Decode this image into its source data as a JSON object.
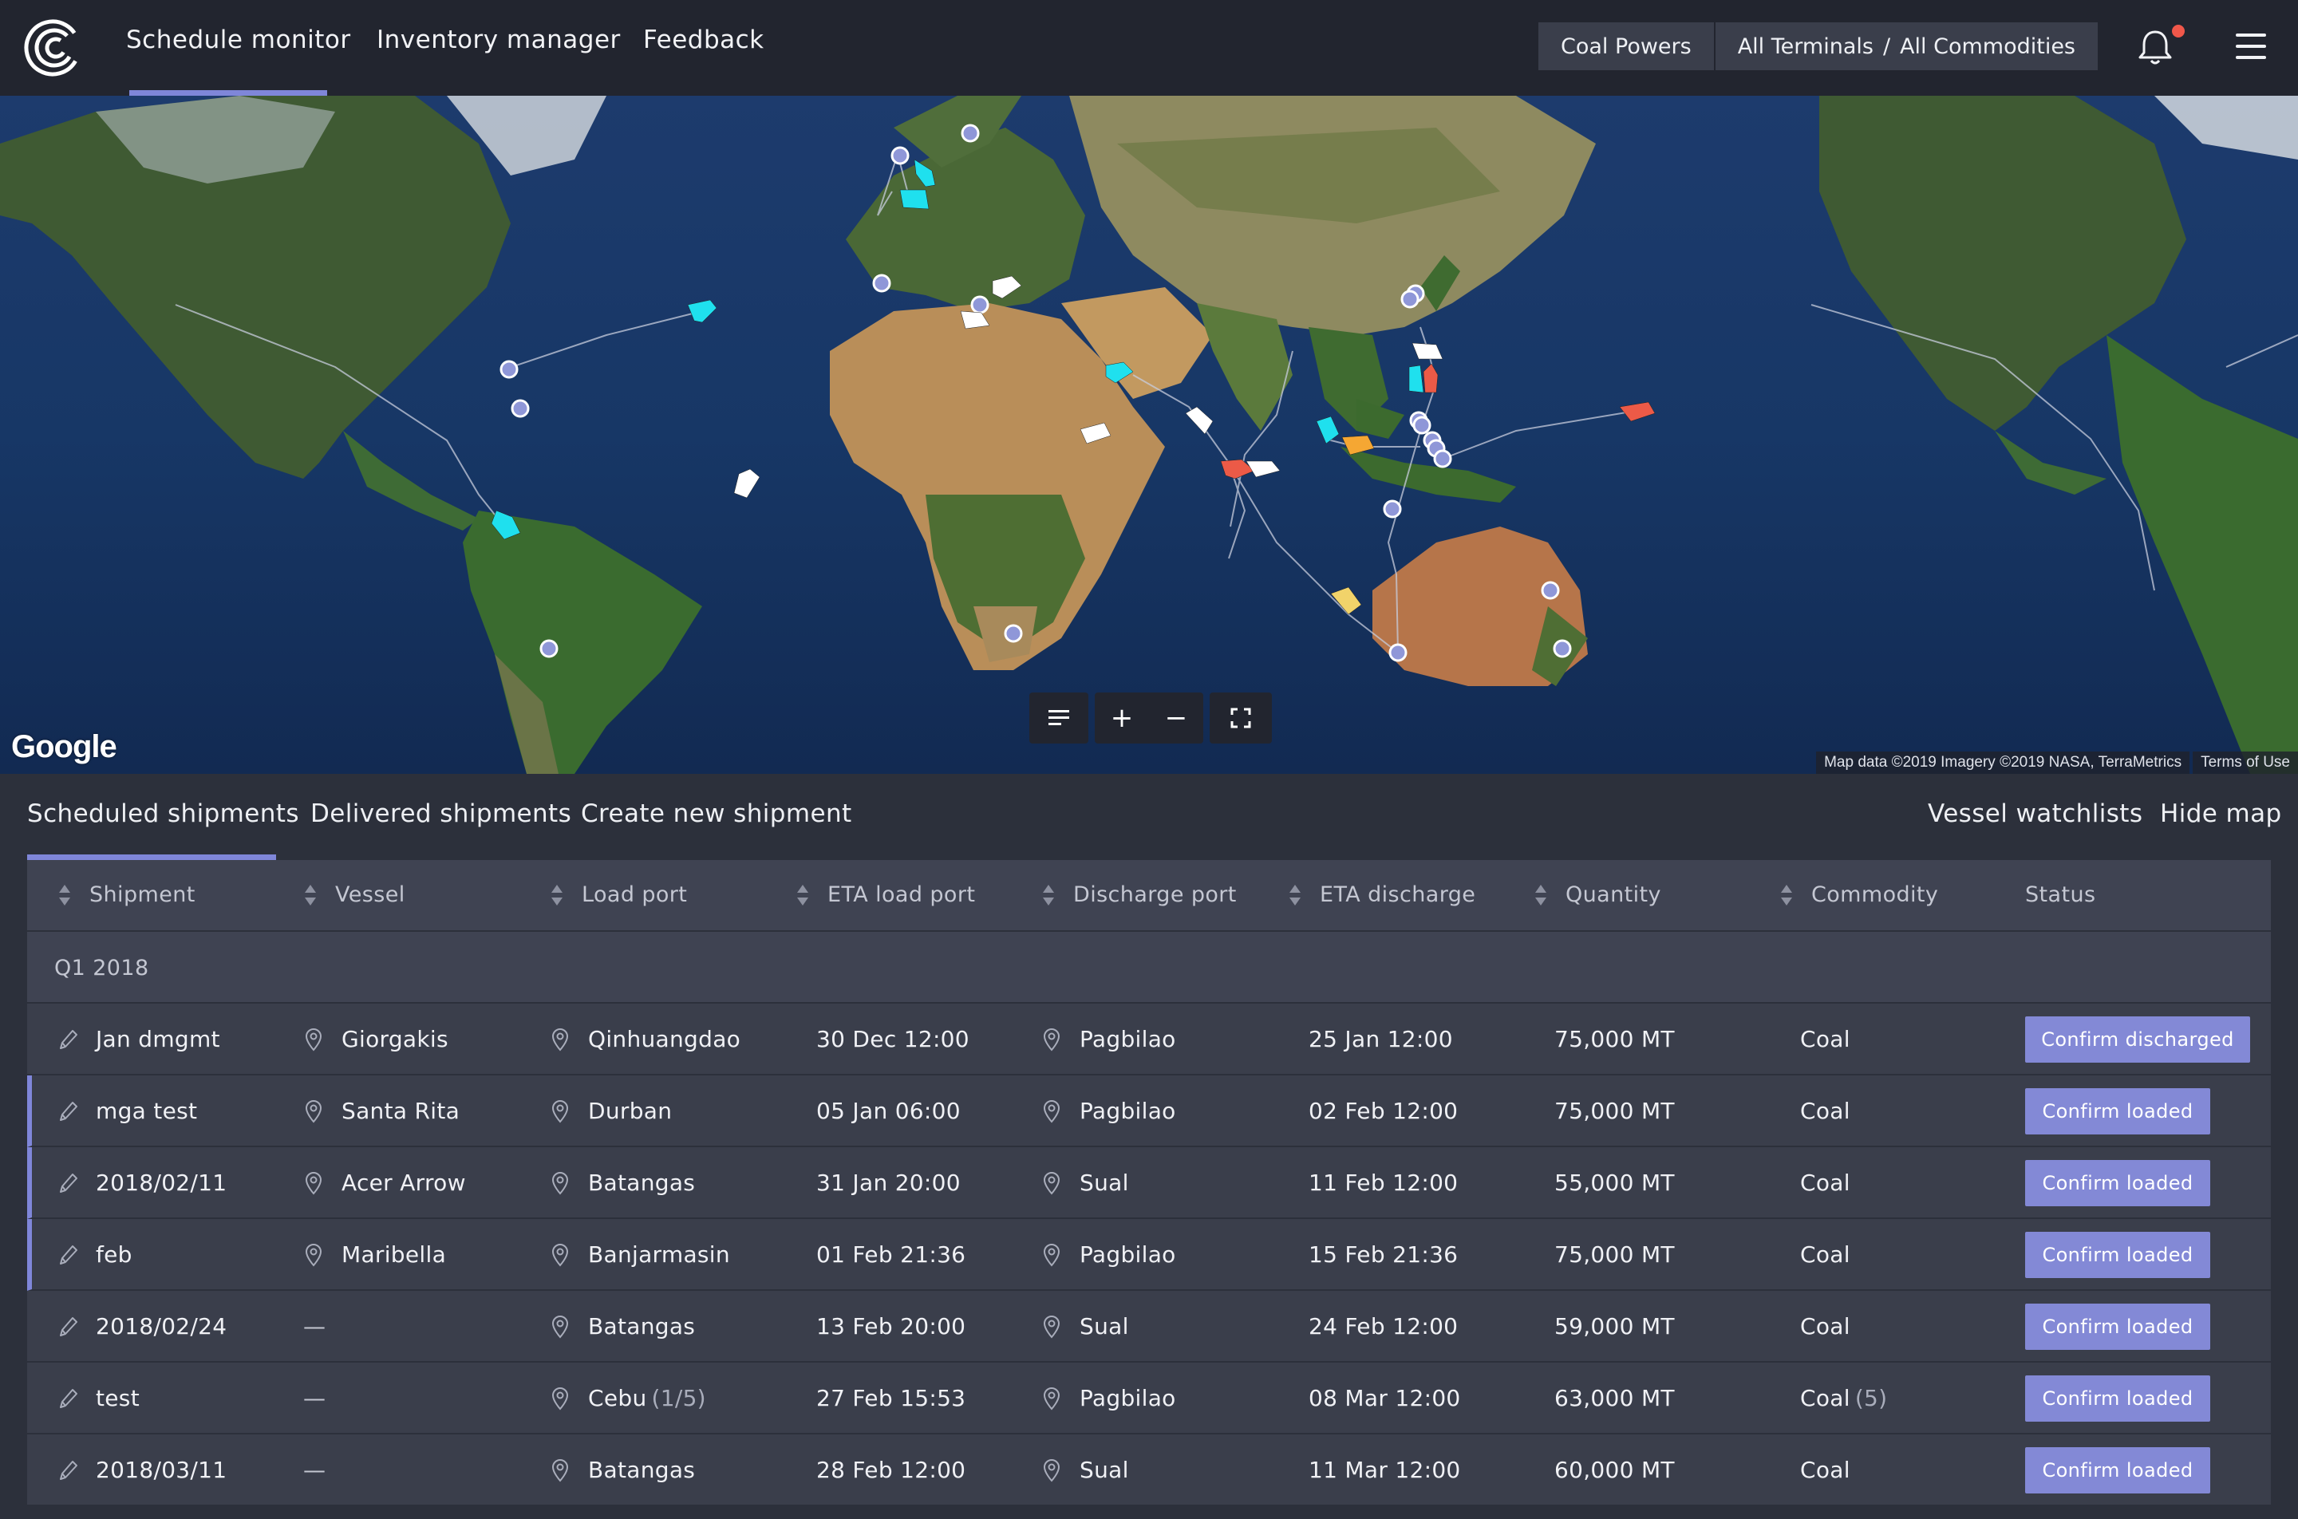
{
  "nav": {
    "links": [
      "Schedule monitor",
      "Inventory manager",
      "Feedback"
    ],
    "company": "Coal Powers",
    "terminals": "All Terminals",
    "separator": "/",
    "commodities": "All Commodities",
    "icons": [
      "logo-icon",
      "bell-icon",
      "hamburger-menu-icon"
    ],
    "notification": true
  },
  "map": {
    "logo": "Google",
    "attribution": "Map data ©2019 Imagery ©2019 NASA, TerraMetrics",
    "terms": "Terms of Use",
    "controls": {
      "legend": "list-icon",
      "zoom_in": "+",
      "zoom_out": "−",
      "fullscreen": "fullscreen-icon"
    },
    "vessel_colors": {
      "cyan": "#1fe0ee",
      "white": "#ffffff",
      "red": "#ec5a47",
      "orange": "#f5a733",
      "yellow": "#f1d36a"
    },
    "port_color": "#8f97d8"
  },
  "tabs": {
    "scheduled": "Scheduled shipments",
    "delivered": "Delivered shipments",
    "create": "Create new shipment",
    "watchlists": "Vessel watchlists",
    "hide_map": "Hide map"
  },
  "table": {
    "headers": [
      "Shipment",
      "Vessel",
      "Load port",
      "ETA load port",
      "Discharge port",
      "ETA discharge",
      "Quantity",
      "Commodity",
      "Status"
    ],
    "group": "Q1 2018",
    "empty": "—",
    "rows": [
      {
        "shipment": "Jan dmgmt",
        "vessel": "Giorgakis",
        "load_port": "Qinhuangdao",
        "load_sub": "",
        "eta_load": "30 Dec 12:00",
        "discharge_port": "Pagbilao",
        "eta_discharge": "25 Jan 12:00",
        "quantity": "75,000 MT",
        "commodity": "Coal",
        "commodity_sub": "",
        "status": "Confirm discharged",
        "marked": false
      },
      {
        "shipment": "mga test",
        "vessel": "Santa Rita",
        "load_port": "Durban",
        "load_sub": "",
        "eta_load": "05 Jan 06:00",
        "discharge_port": "Pagbilao",
        "eta_discharge": "02 Feb 12:00",
        "quantity": "75,000 MT",
        "commodity": "Coal",
        "commodity_sub": "",
        "status": "Confirm loaded",
        "marked": true
      },
      {
        "shipment": "2018/02/11",
        "vessel": "Acer Arrow",
        "load_port": "Batangas",
        "load_sub": "",
        "eta_load": "31 Jan 20:00",
        "discharge_port": "Sual",
        "eta_discharge": "11 Feb 12:00",
        "quantity": "55,000 MT",
        "commodity": "Coal",
        "commodity_sub": "",
        "status": "Confirm loaded",
        "marked": true
      },
      {
        "shipment": "feb",
        "vessel": "Maribella",
        "load_port": "Banjarmasin",
        "load_sub": "",
        "eta_load": "01 Feb 21:36",
        "discharge_port": "Pagbilao",
        "eta_discharge": "15 Feb 21:36",
        "quantity": "75,000 MT",
        "commodity": "Coal",
        "commodity_sub": "",
        "status": "Confirm loaded",
        "marked": true
      },
      {
        "shipment": "2018/02/24",
        "vessel": "",
        "load_port": "Batangas",
        "load_sub": "",
        "eta_load": "13 Feb 20:00",
        "discharge_port": "Sual",
        "eta_discharge": "24 Feb 12:00",
        "quantity": "59,000 MT",
        "commodity": "Coal",
        "commodity_sub": "",
        "status": "Confirm loaded",
        "marked": false
      },
      {
        "shipment": "test",
        "vessel": "",
        "load_port": "Cebu",
        "load_sub": "(1/5)",
        "eta_load": "27 Feb 15:53",
        "discharge_port": "Pagbilao",
        "eta_discharge": "08 Mar 12:00",
        "quantity": "63,000 MT",
        "commodity": "Coal",
        "commodity_sub": "(5)",
        "status": "Confirm loaded",
        "marked": false
      },
      {
        "shipment": "2018/03/11",
        "vessel": "",
        "load_port": "Batangas",
        "load_sub": "",
        "eta_load": "28 Feb 12:00",
        "discharge_port": "Sual",
        "eta_discharge": "11 Mar 12:00",
        "quantity": "60,000 MT",
        "commodity": "Coal",
        "commodity_sub": "",
        "status": "Confirm loaded",
        "marked": false
      }
    ]
  }
}
